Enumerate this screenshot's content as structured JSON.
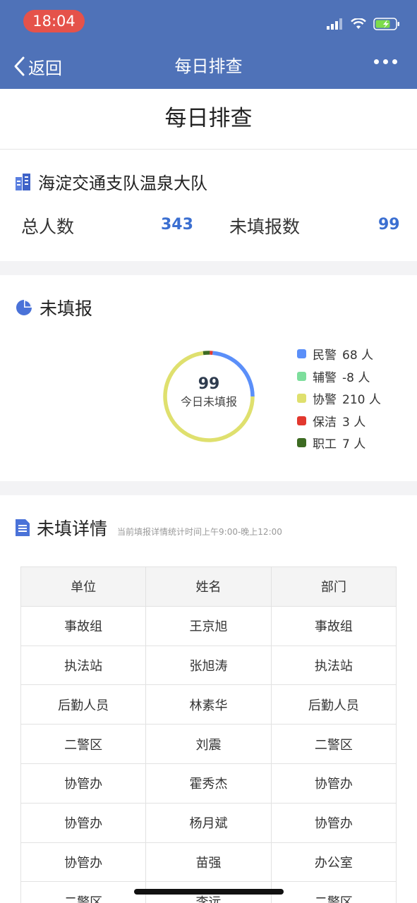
{
  "status_bar": {
    "time": "18:04"
  },
  "nav": {
    "back_label": "返回",
    "title": "每日排查"
  },
  "page_title": "每日排查",
  "unit": {
    "name": "海淀交通支队温泉大队",
    "total_label": "总人数",
    "total_value": "343",
    "unfilled_label": "未填报数",
    "unfilled_value": "99"
  },
  "chart_section": {
    "title": "未填报",
    "center_value": "99",
    "center_label": "今日未填报"
  },
  "chart_data": {
    "type": "pie",
    "categories": [
      "民警",
      "辅警",
      "协警",
      "保洁",
      "职工"
    ],
    "values": [
      68,
      -8,
      210,
      3,
      7
    ],
    "colors": [
      "#5b8ff9",
      "#7dde9c",
      "#dfe06e",
      "#e2382e",
      "#3d6b22"
    ],
    "legend": [
      {
        "name": "民警",
        "value": "68 人"
      },
      {
        "name": "辅警",
        "value": "-8 人"
      },
      {
        "name": "协警",
        "value": "210 人"
      },
      {
        "name": "保洁",
        "value": "3 人"
      },
      {
        "name": "职工",
        "value": "7 人"
      }
    ]
  },
  "detail": {
    "title": "未填详情",
    "note": "当前填报详情统计时间上午9:00-晚上12:00",
    "columns": [
      "单位",
      "姓名",
      "部门"
    ],
    "rows": [
      [
        "事故组",
        "王京旭",
        "事故组"
      ],
      [
        "执法站",
        "张旭涛",
        "执法站"
      ],
      [
        "后勤人员",
        "林素华",
        "后勤人员"
      ],
      [
        "二警区",
        "刘震",
        "二警区"
      ],
      [
        "协管办",
        "霍秀杰",
        "协管办"
      ],
      [
        "协管办",
        "杨月斌",
        "协管办"
      ],
      [
        "协管办",
        "苗强",
        "办公室"
      ],
      [
        "二警区",
        "李远",
        "二警区"
      ]
    ]
  }
}
